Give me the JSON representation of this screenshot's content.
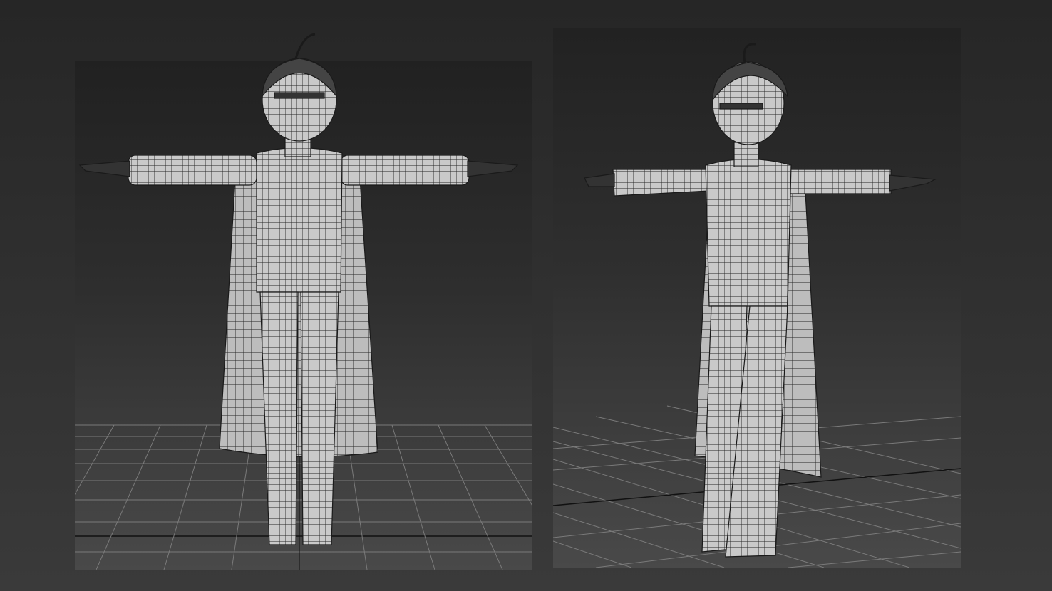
{
  "scene": {
    "viewports": [
      {
        "view": "front"
      },
      {
        "view": "perspective"
      }
    ],
    "colors": {
      "background": "#2e2e2e",
      "grid_line": "#7a7a7a",
      "mesh_fill": "#c9c9c9",
      "mesh_wire": "#222222"
    }
  }
}
